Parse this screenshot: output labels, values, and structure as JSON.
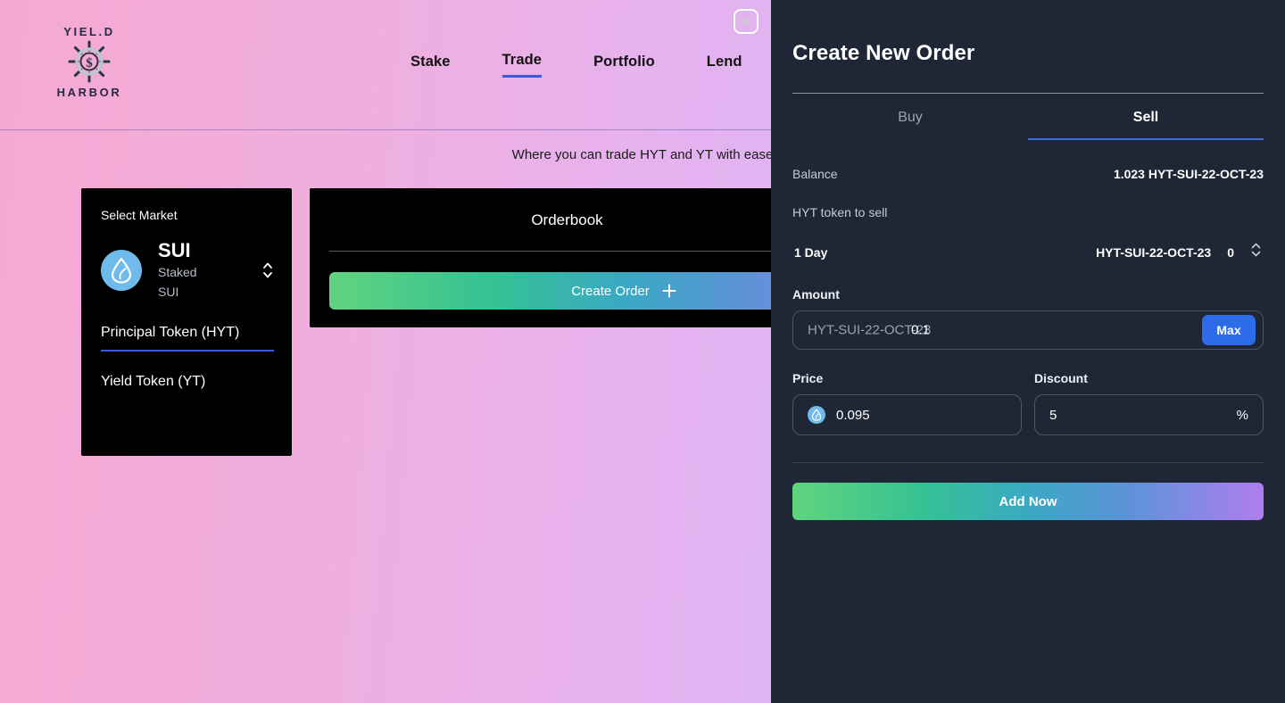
{
  "brand": {
    "top_text": "YIEL.D",
    "bottom_text": "HARBOR",
    "logo_icon": "ship-wheel-dollar-icon"
  },
  "nav": {
    "items": [
      {
        "label": "Stake",
        "active": false
      },
      {
        "label": "Trade",
        "active": true
      },
      {
        "label": "Portfolio",
        "active": false
      },
      {
        "label": "Lend",
        "active": false
      }
    ]
  },
  "page": {
    "subtitle": "Where you can trade HYT and YT with ease",
    "close_icon": "close-icon"
  },
  "market_card": {
    "title": "Select Market",
    "coin_icon": "sui-droplet-icon",
    "coin_name": "SUI",
    "coin_sub_line1": "Staked",
    "coin_sub_line2": "SUI",
    "stepper_icon": "chevron-up-down-icon",
    "tabs": [
      {
        "label": "Principal Token (HYT)",
        "active": true
      },
      {
        "label": "Yield Token (YT)",
        "active": false
      }
    ]
  },
  "orderbook": {
    "title": "Orderbook",
    "create_order_label": "Create Order",
    "plus_icon": "plus-icon"
  },
  "drawer": {
    "title": "Create New Order",
    "tabs": [
      {
        "label": "Buy",
        "active": false
      },
      {
        "label": "Sell",
        "active": true
      }
    ],
    "balance_label": "Balance",
    "balance_value": "1.023 HYT-SUI-22-OCT-23",
    "token_section_label": "HYT token to sell",
    "term_row": {
      "duration": "1 Day",
      "token": "HYT-SUI-22-OCT-23",
      "quantity": "0",
      "stepper_icon": "chevron-up-down-icon"
    },
    "amount": {
      "label": "Amount",
      "placeholder": "HYT-SUI-22-OCT-23",
      "value": "0.1",
      "max_label": "Max"
    },
    "price": {
      "label": "Price",
      "icon": "sui-droplet-icon",
      "value": "0.095"
    },
    "discount": {
      "label": "Discount",
      "value": "5",
      "suffix": "%"
    },
    "submit_label": "Add Now"
  },
  "colors": {
    "accent_blue": "#3b5bdb",
    "max_button_blue": "#2d6ce8",
    "panel_bg": "#1f2736",
    "card_bg": "#000000",
    "sui_blue": "#6fbcec",
    "gradient_start": "#5fd47e",
    "gradient_end": "#b07df0",
    "bg_gradient_start": "#f5a9d2",
    "bg_gradient_end": "#c3b0f7"
  }
}
